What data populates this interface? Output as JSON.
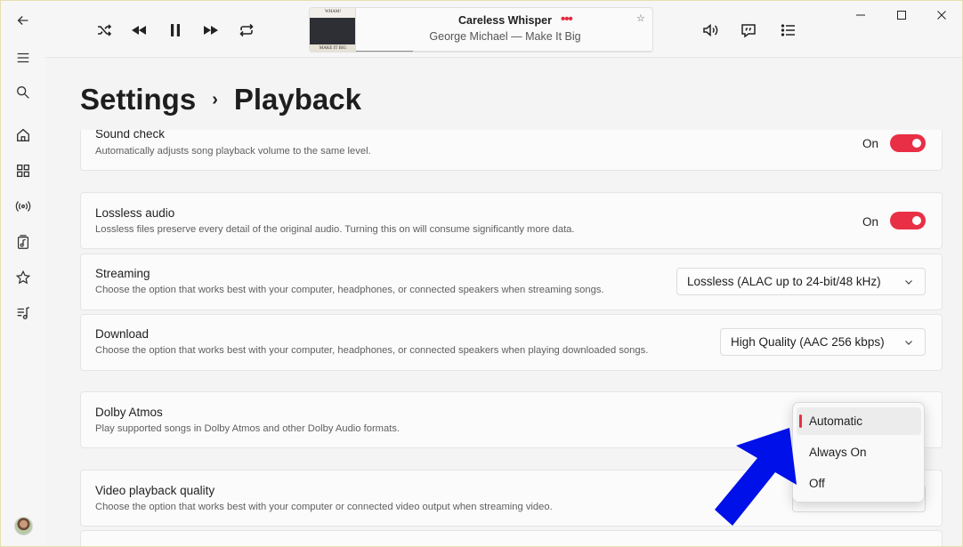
{
  "colors": {
    "accent": "#e82f45",
    "toggle_on": "#e82f45",
    "annotation_arrow": "#0010e8",
    "window_bg": "#f4f4f4"
  },
  "sidebar": {
    "items": [
      {
        "icon": "back-arrow-icon"
      },
      {
        "icon": "menu-icon"
      },
      {
        "icon": "search-icon"
      },
      {
        "icon": "home-icon"
      },
      {
        "icon": "browse-grid-icon"
      },
      {
        "icon": "radio-broadcast-icon"
      },
      {
        "icon": "library-music-icon"
      },
      {
        "icon": "star-icon"
      },
      {
        "icon": "playlist-icon"
      }
    ],
    "avatar": "user-avatar"
  },
  "player": {
    "controls": [
      "shuffle-icon",
      "previous-icon",
      "pause-icon",
      "next-icon",
      "repeat-icon"
    ],
    "now_playing": {
      "title": "Careless Whisper",
      "subtitle": "George Michael — Make It Big",
      "more": "•••",
      "favorite": "☆",
      "art_text_top": "WHAM!",
      "art_text_bottom": "MAKE IT BIG",
      "progress": 0.19
    },
    "right_controls": [
      "volume-icon",
      "lyrics-icon",
      "queue-list-icon"
    ]
  },
  "window_controls": [
    "minimize-icon",
    "maximize-icon",
    "close-icon"
  ],
  "breadcrumb": {
    "root": "Settings",
    "separator": "›",
    "current": "Playback"
  },
  "settings": {
    "sound_check": {
      "title": "Sound check",
      "description": "Automatically adjusts song playback volume to the same level.",
      "state_label": "On",
      "on": true
    },
    "lossless": {
      "title": "Lossless audio",
      "description": "Lossless files preserve every detail of the original audio. Turning this on will consume significantly more data.",
      "state_label": "On",
      "on": true
    },
    "streaming": {
      "title": "Streaming",
      "description": "Choose the option that works best with your computer, headphones, or connected speakers when streaming songs.",
      "value": "Lossless (ALAC up to 24-bit/48 kHz)"
    },
    "download": {
      "title": "Download",
      "description": "Choose the option that works best with your computer, headphones, or connected speakers when playing downloaded songs.",
      "value": "High Quality (AAC 256 kbps)"
    },
    "dolby": {
      "title": "Dolby Atmos",
      "description": "Play supported songs in Dolby Atmos and other Dolby Audio formats.",
      "options": [
        "Automatic",
        "Always On",
        "Off"
      ],
      "selected": "Automatic"
    },
    "video": {
      "title": "Video playback quality",
      "description": "Choose the option that works best with your computer or connected video output when streaming video."
    }
  }
}
